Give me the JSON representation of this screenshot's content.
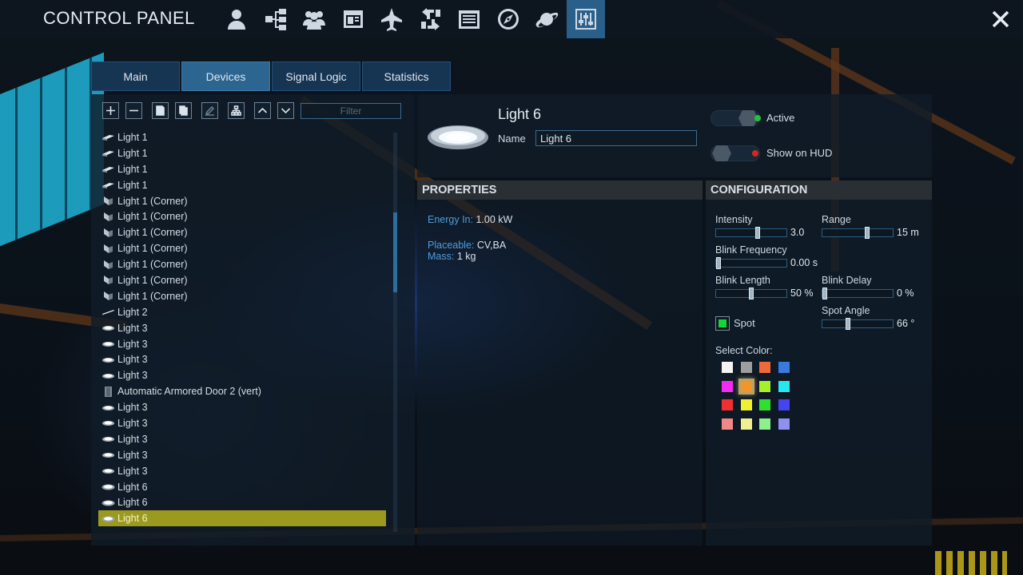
{
  "header": {
    "title": "CONTROL PANEL",
    "icons": [
      "person-icon",
      "structure-tree-icon",
      "group-icon",
      "window-icon",
      "ship-icon",
      "swap-arrows-icon",
      "list-icon",
      "compass-icon",
      "planet-icon",
      "sliders-icon"
    ],
    "active_icon_index": 9,
    "close_icon": "close-icon"
  },
  "tabs": [
    {
      "label": "Main"
    },
    {
      "label": "Devices"
    },
    {
      "label": "Signal Logic"
    },
    {
      "label": "Statistics"
    }
  ],
  "active_tab_index": 1,
  "toolbar": {
    "buttons": [
      "add-icon",
      "remove-icon",
      "copy-icon",
      "paste-icon",
      "edit-icon",
      "group-icon",
      "move-up-icon",
      "move-down-icon"
    ],
    "filter_placeholder": "Filter"
  },
  "devices": [
    {
      "label": "Light 1",
      "icon": "light-flat-icon"
    },
    {
      "label": "Light 1",
      "icon": "light-flat-icon"
    },
    {
      "label": "Light 1",
      "icon": "light-flat-icon"
    },
    {
      "label": "Light 1",
      "icon": "light-flat-icon"
    },
    {
      "label": "Light 1 (Corner)",
      "icon": "light-corner-icon"
    },
    {
      "label": "Light 1 (Corner)",
      "icon": "light-corner-icon"
    },
    {
      "label": "Light 1 (Corner)",
      "icon": "light-corner-icon"
    },
    {
      "label": "Light 1 (Corner)",
      "icon": "light-corner-icon"
    },
    {
      "label": "Light 1 (Corner)",
      "icon": "light-corner-icon"
    },
    {
      "label": "Light 1 (Corner)",
      "icon": "light-corner-icon"
    },
    {
      "label": "Light 1 (Corner)",
      "icon": "light-corner-icon"
    },
    {
      "label": "Light 2",
      "icon": "light-tube-icon"
    },
    {
      "label": "Light 3",
      "icon": "light-round-icon"
    },
    {
      "label": "Light 3",
      "icon": "light-round-icon"
    },
    {
      "label": "Light 3",
      "icon": "light-round-icon"
    },
    {
      "label": "Light 3",
      "icon": "light-round-icon"
    },
    {
      "label": "Automatic Armored Door 2 (vert)",
      "icon": "door-icon"
    },
    {
      "label": "Light 3",
      "icon": "light-round-icon"
    },
    {
      "label": "Light 3",
      "icon": "light-round-icon"
    },
    {
      "label": "Light 3",
      "icon": "light-round-icon"
    },
    {
      "label": "Light 3",
      "icon": "light-round-icon"
    },
    {
      "label": "Light 3",
      "icon": "light-round-icon"
    },
    {
      "label": "Light 6",
      "icon": "light-disc-icon"
    },
    {
      "label": "Light 6",
      "icon": "light-disc-icon"
    },
    {
      "label": "Light 6",
      "icon": "light-disc-icon"
    }
  ],
  "selected_device_index": 24,
  "list_scroll_position": 0.25,
  "detail": {
    "title": "Light 6",
    "name_label": "Name",
    "name_value": "Light 6",
    "active_label": "Active",
    "active_on": true,
    "active_led_color": "#1dc536",
    "hud_label": "Show on HUD",
    "hud_on": false,
    "hud_led_color": "#d12a1c"
  },
  "properties": {
    "heading": "PROPERTIES",
    "energy_key": "Energy In:",
    "energy_val": "1.00 kW",
    "placeable_key": "Placeable:",
    "placeable_val": "CV,BA",
    "mass_key": "Mass:",
    "mass_val": "1 kg"
  },
  "configuration": {
    "heading": "CONFIGURATION",
    "intensity": {
      "label": "Intensity",
      "value_text": "3.0",
      "fraction": 0.6
    },
    "range": {
      "label": "Range",
      "value_text": "15 m",
      "fraction": 0.65
    },
    "blink_frequency": {
      "label": "Blink Frequency",
      "value_text": "0.00 s",
      "fraction": 0.0
    },
    "blink_length": {
      "label": "Blink Length",
      "value_text": "50 %",
      "fraction": 0.5
    },
    "blink_delay": {
      "label": "Blink Delay",
      "value_text": "0 %",
      "fraction": 0.0
    },
    "spot_label": "Spot",
    "spot_checked": true,
    "spot_angle": {
      "label": "Spot Angle",
      "value_text": "66 °",
      "fraction": 0.35
    },
    "select_color_label": "Select Color:",
    "colors": [
      "#f4f4f4",
      "#9e9e9e",
      "#ef6a3a",
      "#3a79e0",
      "#f02cf0",
      "#f0962a",
      "#a6f030",
      "#27e6ee",
      "#f03030",
      "#f0f030",
      "#30e030",
      "#4444f0",
      "#f08888",
      "#f0f090",
      "#8cf08c",
      "#9090f0"
    ],
    "selected_color_index": 5
  }
}
